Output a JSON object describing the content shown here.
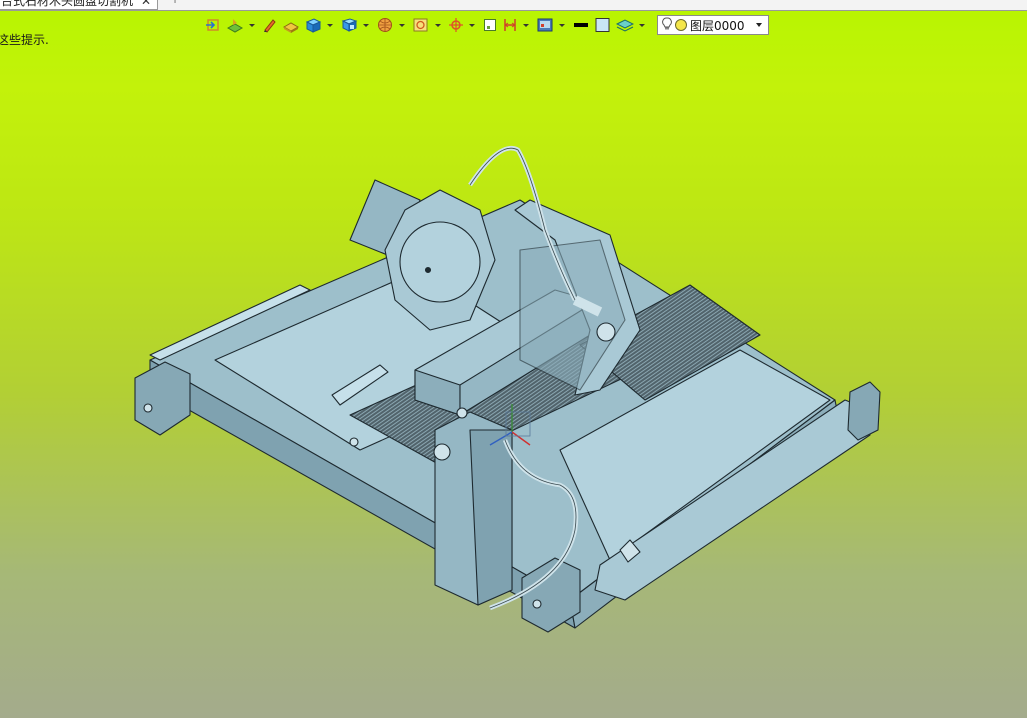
{
  "tab": {
    "title": "台式石材木头圆盘切割机",
    "close_glyph": "✕",
    "new_tab_glyph": "+"
  },
  "hint_text": "这些提示.",
  "toolbar": {
    "icons": [
      "exit-sketch-icon",
      "sketch-plane-icon",
      "pen-icon",
      "extrude-face-icon",
      "solid-box-icon",
      "shell-icon",
      "sphere-grid-icon",
      "view-orient-icon",
      "axis-icon",
      "small-square-icon",
      "dimension-icon",
      "display-mode-icon",
      "line-color-swatch",
      "face-color-swatch",
      "layer-stack-icon"
    ],
    "line_color": "#000000",
    "face_color": "#c9e6f5"
  },
  "layer": {
    "name": "图层0000",
    "bulb_icon": "lightbulb-icon",
    "dot_color": "#f4e64a"
  },
  "colors": {
    "model_fill": "#a6c7d3",
    "model_dark": "#7fa2b0",
    "model_edge": "#1e2a30",
    "bg_top": "#b7f500",
    "bg_bottom": "#a4ab8c"
  }
}
